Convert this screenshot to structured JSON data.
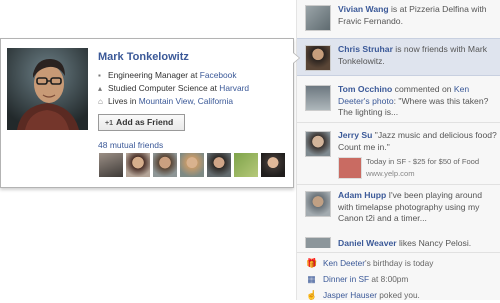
{
  "profile_card": {
    "name": "Mark Tonkelowitz",
    "job_prefix": "Engineering Manager at ",
    "job_employer": "Facebook",
    "study_prefix": "Studied Computer Science at ",
    "study_school": "Harvard",
    "lives_prefix": "Lives in ",
    "lives_place": "Mountain View, California",
    "add_button": "Add as Friend",
    "add_button_icon": "+1",
    "mutual_friends": "48 mutual friends",
    "mutual_friend_count_shown": 7
  },
  "ticker": {
    "items": [
      {
        "actor": "Vivian Wang",
        "text": " is at Pizzeria Delfina with Fravic Fernando."
      },
      {
        "actor": "Chris Struhar",
        "text": " is now friends with Mark Tonkelowitz."
      },
      {
        "actor": "Tom Occhino",
        "text_before": " commented on ",
        "target": "Ken Deeter's photo",
        "text_after": ": \"Where was this taken? The lighting is..."
      },
      {
        "actor": "Jerry Su",
        "text": " \"Jazz music and delicious food? Count me in.\"",
        "attachment_title": "Today in SF - $25 for $50 of Food",
        "attachment_url": "www.yelp.com"
      },
      {
        "actor": "Adam Hupp",
        "text": " I've been playing around with timelapse photography using my Canon t2i and a timer..."
      },
      {
        "actor": "Daniel Weaver",
        "text": " likes Nancy Pelosi."
      }
    ],
    "reminders": [
      {
        "icon": "birthday-icon",
        "glyph": "🎁",
        "link": "Ken Deeter",
        "text": "'s birthday is today"
      },
      {
        "icon": "calendar-icon",
        "glyph": "▦",
        "link": "Dinner in SF",
        "text": " at 8:00pm"
      },
      {
        "icon": "poke-icon",
        "glyph": "☝",
        "link": "Jasper Hauser",
        "text": " poked you."
      }
    ]
  },
  "colors": {
    "link": "#3b5998",
    "active_row": "#dfe4ee",
    "ticker_bg": "#f7f7f7"
  }
}
